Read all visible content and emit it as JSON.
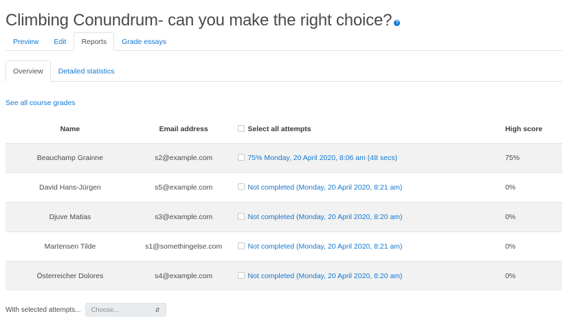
{
  "quiz": {
    "title": "Climbing Conundrum- can you make the right choice?",
    "help_icon": "question-icon"
  },
  "primary_tabs": [
    {
      "label": "Preview",
      "active": false
    },
    {
      "label": "Edit",
      "active": false
    },
    {
      "label": "Reports",
      "active": true
    },
    {
      "label": "Grade essays",
      "active": false
    }
  ],
  "secondary_tabs": [
    {
      "label": "Overview",
      "active": true
    },
    {
      "label": "Detailed statistics",
      "active": false
    }
  ],
  "links": {
    "all_grades": "See all course grades"
  },
  "table": {
    "headers": {
      "name": "Name",
      "email": "Email address",
      "select_all": "Select all attempts",
      "high_score": "High score"
    },
    "rows": [
      {
        "name": "Beauchamp Grainne",
        "email": "s2@example.com",
        "attempt": "75% Monday, 20 April 2020, 8:06 am (48 secs)",
        "score": "75%"
      },
      {
        "name": "David Hans-Jürgen",
        "email": "s5@example.com",
        "attempt": "Not completed (Monday, 20 April 2020, 8:21 am)",
        "score": "0%"
      },
      {
        "name": "Djuve Matias",
        "email": "s3@example.com",
        "attempt": "Not completed (Monday, 20 April 2020, 8:20 am)",
        "score": "0%"
      },
      {
        "name": "Martensen Tilde",
        "email": "s1@somethingelse.com",
        "attempt": "Not completed (Monday, 20 April 2020, 8:21 am)",
        "score": "0%"
      },
      {
        "name": "Österreicher Dolores",
        "email": "s4@example.com",
        "attempt": "Not completed (Monday, 20 April 2020, 8:20 am)",
        "score": "0%"
      }
    ]
  },
  "bulk": {
    "label": "With selected attempts...",
    "select_value": "Choose..."
  },
  "colors": {
    "link": "#1177d1",
    "row_stripe": "#f2f2f2"
  }
}
